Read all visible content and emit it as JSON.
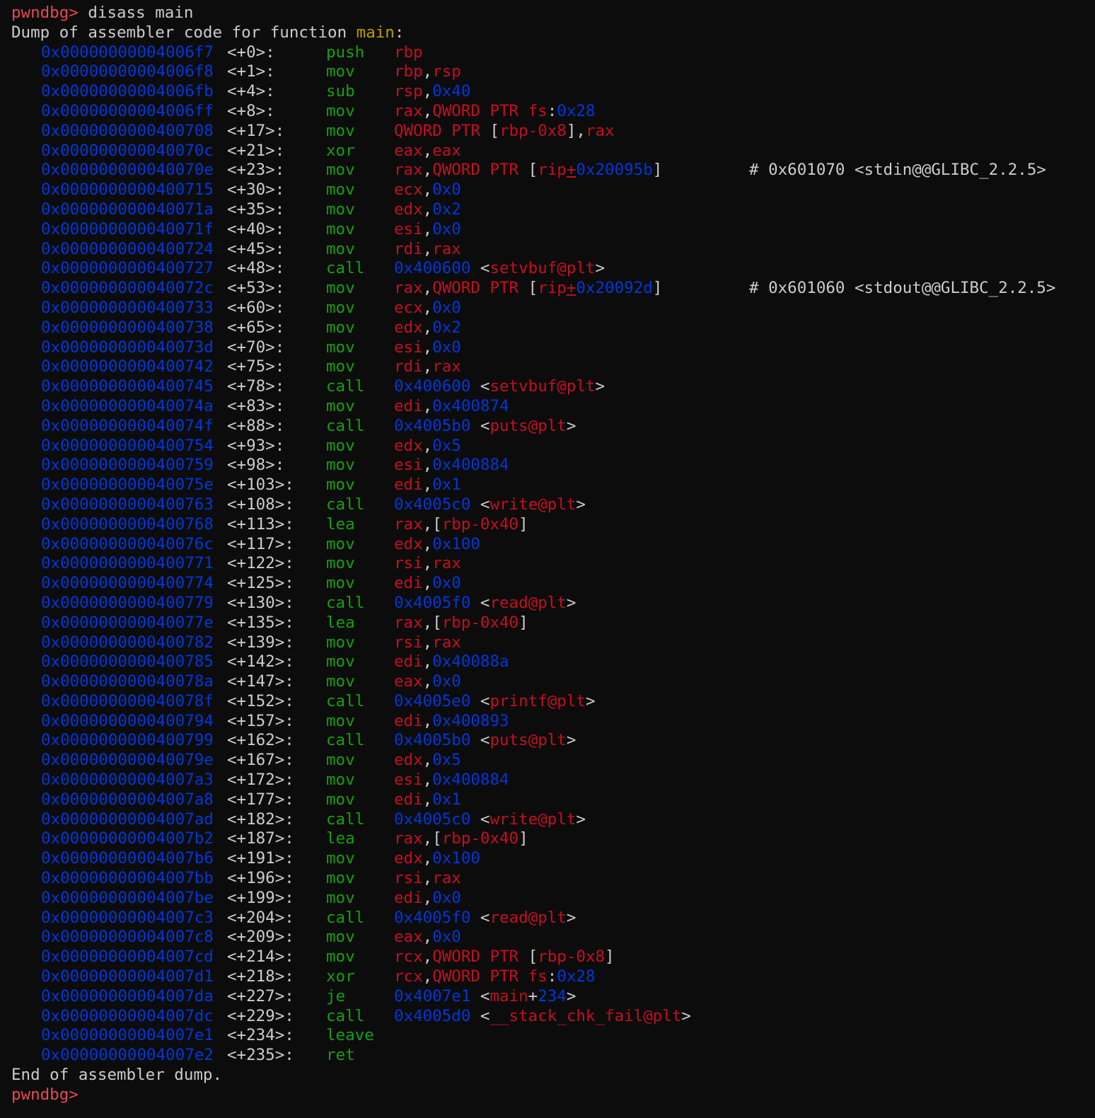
{
  "terminal": {
    "prompt": "pwndbg>",
    "command": "disass main",
    "header_prefix": "Dump of assembler code for function ",
    "function_name": "main",
    "header_suffix": ":",
    "footer": "End of assembler dump.",
    "final_prompt": "pwndbg>"
  },
  "colors": {
    "background": "#0c0c0c",
    "address": "#0037da",
    "mnemonic": "#13a10e",
    "register": "#c50f1f",
    "prompt": "#e74856",
    "function": "#c19c00",
    "text": "#cccccc"
  },
  "instructions": [
    {
      "addr": "0x00000000004006f7",
      "off": "<+0>:",
      "mnem": "push",
      "ops": [
        [
          "reg",
          "rbp"
        ]
      ]
    },
    {
      "addr": "0x00000000004006f8",
      "off": "<+1>:",
      "mnem": "mov",
      "ops": [
        [
          "reg",
          "rbp"
        ],
        [
          "txt",
          ","
        ],
        [
          "reg",
          "rsp"
        ]
      ]
    },
    {
      "addr": "0x00000000004006fb",
      "off": "<+4>:",
      "mnem": "sub",
      "ops": [
        [
          "reg",
          "rsp"
        ],
        [
          "txt",
          ","
        ],
        [
          "num",
          "0x40"
        ]
      ]
    },
    {
      "addr": "0x00000000004006ff",
      "off": "<+8>:",
      "mnem": "mov",
      "ops": [
        [
          "reg",
          "rax"
        ],
        [
          "txt",
          ","
        ],
        [
          "reg",
          "QWORD PTR fs"
        ],
        [
          "txt",
          ":"
        ],
        [
          "num",
          "0x28"
        ]
      ]
    },
    {
      "addr": "0x0000000000400708",
      "off": "<+17>:",
      "mnem": "mov",
      "ops": [
        [
          "reg",
          "QWORD PTR "
        ],
        [
          "txt",
          "["
        ],
        [
          "reg",
          "rbp-0x8"
        ],
        [
          "txt",
          "]"
        ],
        [
          "txt",
          ","
        ],
        [
          "reg",
          "rax"
        ]
      ]
    },
    {
      "addr": "0x000000000040070c",
      "off": "<+21>:",
      "mnem": "xor",
      "ops": [
        [
          "reg",
          "eax"
        ],
        [
          "txt",
          ","
        ],
        [
          "reg",
          "eax"
        ]
      ]
    },
    {
      "addr": "0x000000000040070e",
      "off": "<+23>:",
      "mnem": "mov",
      "ops": [
        [
          "reg",
          "rax"
        ],
        [
          "txt",
          ","
        ],
        [
          "reg",
          "QWORD PTR "
        ],
        [
          "txt",
          "["
        ],
        [
          "reg",
          "rip"
        ],
        [
          "reg_u",
          "+"
        ],
        [
          "num",
          "0x20095b"
        ],
        [
          "txt",
          "]"
        ]
      ],
      "comment": "# 0x601070 <stdin@@GLIBC_2.2.5>"
    },
    {
      "addr": "0x0000000000400715",
      "off": "<+30>:",
      "mnem": "mov",
      "ops": [
        [
          "reg",
          "ecx"
        ],
        [
          "txt",
          ","
        ],
        [
          "num",
          "0x0"
        ]
      ]
    },
    {
      "addr": "0x000000000040071a",
      "off": "<+35>:",
      "mnem": "mov",
      "ops": [
        [
          "reg",
          "edx"
        ],
        [
          "txt",
          ","
        ],
        [
          "num",
          "0x2"
        ]
      ]
    },
    {
      "addr": "0x000000000040071f",
      "off": "<+40>:",
      "mnem": "mov",
      "ops": [
        [
          "reg",
          "esi"
        ],
        [
          "txt",
          ","
        ],
        [
          "num",
          "0x0"
        ]
      ]
    },
    {
      "addr": "0x0000000000400724",
      "off": "<+45>:",
      "mnem": "mov",
      "ops": [
        [
          "reg",
          "rdi"
        ],
        [
          "txt",
          ","
        ],
        [
          "reg",
          "rax"
        ]
      ]
    },
    {
      "addr": "0x0000000000400727",
      "off": "<+48>:",
      "mnem": "call",
      "ops": [
        [
          "num",
          "0x400600"
        ],
        [
          "txt",
          " <"
        ],
        [
          "sym",
          "setvbuf@plt"
        ],
        [
          "txt",
          ">"
        ]
      ]
    },
    {
      "addr": "0x000000000040072c",
      "off": "<+53>:",
      "mnem": "mov",
      "ops": [
        [
          "reg",
          "rax"
        ],
        [
          "txt",
          ","
        ],
        [
          "reg",
          "QWORD PTR "
        ],
        [
          "txt",
          "["
        ],
        [
          "reg",
          "rip"
        ],
        [
          "reg_u",
          "+"
        ],
        [
          "num",
          "0x20092d"
        ],
        [
          "txt",
          "]"
        ]
      ],
      "comment": "# 0x601060 <stdout@@GLIBC_2.2.5>"
    },
    {
      "addr": "0x0000000000400733",
      "off": "<+60>:",
      "mnem": "mov",
      "ops": [
        [
          "reg",
          "ecx"
        ],
        [
          "txt",
          ","
        ],
        [
          "num",
          "0x0"
        ]
      ]
    },
    {
      "addr": "0x0000000000400738",
      "off": "<+65>:",
      "mnem": "mov",
      "ops": [
        [
          "reg",
          "edx"
        ],
        [
          "txt",
          ","
        ],
        [
          "num",
          "0x2"
        ]
      ]
    },
    {
      "addr": "0x000000000040073d",
      "off": "<+70>:",
      "mnem": "mov",
      "ops": [
        [
          "reg",
          "esi"
        ],
        [
          "txt",
          ","
        ],
        [
          "num",
          "0x0"
        ]
      ]
    },
    {
      "addr": "0x0000000000400742",
      "off": "<+75>:",
      "mnem": "mov",
      "ops": [
        [
          "reg",
          "rdi"
        ],
        [
          "txt",
          ","
        ],
        [
          "reg",
          "rax"
        ]
      ]
    },
    {
      "addr": "0x0000000000400745",
      "off": "<+78>:",
      "mnem": "call",
      "ops": [
        [
          "num",
          "0x400600"
        ],
        [
          "txt",
          " <"
        ],
        [
          "sym",
          "setvbuf@plt"
        ],
        [
          "txt",
          ">"
        ]
      ]
    },
    {
      "addr": "0x000000000040074a",
      "off": "<+83>:",
      "mnem": "mov",
      "ops": [
        [
          "reg",
          "edi"
        ],
        [
          "txt",
          ","
        ],
        [
          "num",
          "0x400874"
        ]
      ]
    },
    {
      "addr": "0x000000000040074f",
      "off": "<+88>:",
      "mnem": "call",
      "ops": [
        [
          "num",
          "0x4005b0"
        ],
        [
          "txt",
          " <"
        ],
        [
          "sym",
          "puts@plt"
        ],
        [
          "txt",
          ">"
        ]
      ]
    },
    {
      "addr": "0x0000000000400754",
      "off": "<+93>:",
      "mnem": "mov",
      "ops": [
        [
          "reg",
          "edx"
        ],
        [
          "txt",
          ","
        ],
        [
          "num",
          "0x5"
        ]
      ]
    },
    {
      "addr": "0x0000000000400759",
      "off": "<+98>:",
      "mnem": "mov",
      "ops": [
        [
          "reg",
          "esi"
        ],
        [
          "txt",
          ","
        ],
        [
          "num",
          "0x400884"
        ]
      ]
    },
    {
      "addr": "0x000000000040075e",
      "off": "<+103>:",
      "mnem": "mov",
      "ops": [
        [
          "reg",
          "edi"
        ],
        [
          "txt",
          ","
        ],
        [
          "num",
          "0x1"
        ]
      ]
    },
    {
      "addr": "0x0000000000400763",
      "off": "<+108>:",
      "mnem": "call",
      "ops": [
        [
          "num",
          "0x4005c0"
        ],
        [
          "txt",
          " <"
        ],
        [
          "sym",
          "write@plt"
        ],
        [
          "txt",
          ">"
        ]
      ]
    },
    {
      "addr": "0x0000000000400768",
      "off": "<+113>:",
      "mnem": "lea",
      "ops": [
        [
          "reg",
          "rax"
        ],
        [
          "txt",
          ","
        ],
        [
          "txt",
          "["
        ],
        [
          "reg",
          "rbp-0x40"
        ],
        [
          "txt",
          "]"
        ]
      ]
    },
    {
      "addr": "0x000000000040076c",
      "off": "<+117>:",
      "mnem": "mov",
      "ops": [
        [
          "reg",
          "edx"
        ],
        [
          "txt",
          ","
        ],
        [
          "num",
          "0x100"
        ]
      ]
    },
    {
      "addr": "0x0000000000400771",
      "off": "<+122>:",
      "mnem": "mov",
      "ops": [
        [
          "reg",
          "rsi"
        ],
        [
          "txt",
          ","
        ],
        [
          "reg",
          "rax"
        ]
      ]
    },
    {
      "addr": "0x0000000000400774",
      "off": "<+125>:",
      "mnem": "mov",
      "ops": [
        [
          "reg",
          "edi"
        ],
        [
          "txt",
          ","
        ],
        [
          "num",
          "0x0"
        ]
      ]
    },
    {
      "addr": "0x0000000000400779",
      "off": "<+130>:",
      "mnem": "call",
      "ops": [
        [
          "num",
          "0x4005f0"
        ],
        [
          "txt",
          " <"
        ],
        [
          "sym",
          "read@plt"
        ],
        [
          "txt",
          ">"
        ]
      ]
    },
    {
      "addr": "0x000000000040077e",
      "off": "<+135>:",
      "mnem": "lea",
      "ops": [
        [
          "reg",
          "rax"
        ],
        [
          "txt",
          ","
        ],
        [
          "txt",
          "["
        ],
        [
          "reg",
          "rbp-0x40"
        ],
        [
          "txt",
          "]"
        ]
      ]
    },
    {
      "addr": "0x0000000000400782",
      "off": "<+139>:",
      "mnem": "mov",
      "ops": [
        [
          "reg",
          "rsi"
        ],
        [
          "txt",
          ","
        ],
        [
          "reg",
          "rax"
        ]
      ]
    },
    {
      "addr": "0x0000000000400785",
      "off": "<+142>:",
      "mnem": "mov",
      "ops": [
        [
          "reg",
          "edi"
        ],
        [
          "txt",
          ","
        ],
        [
          "num",
          "0x40088a"
        ]
      ]
    },
    {
      "addr": "0x000000000040078a",
      "off": "<+147>:",
      "mnem": "mov",
      "ops": [
        [
          "reg",
          "eax"
        ],
        [
          "txt",
          ","
        ],
        [
          "num",
          "0x0"
        ]
      ]
    },
    {
      "addr": "0x000000000040078f",
      "off": "<+152>:",
      "mnem": "call",
      "ops": [
        [
          "num",
          "0x4005e0"
        ],
        [
          "txt",
          " <"
        ],
        [
          "sym",
          "printf@plt"
        ],
        [
          "txt",
          ">"
        ]
      ]
    },
    {
      "addr": "0x0000000000400794",
      "off": "<+157>:",
      "mnem": "mov",
      "ops": [
        [
          "reg",
          "edi"
        ],
        [
          "txt",
          ","
        ],
        [
          "num",
          "0x400893"
        ]
      ]
    },
    {
      "addr": "0x0000000000400799",
      "off": "<+162>:",
      "mnem": "call",
      "ops": [
        [
          "num",
          "0x4005b0"
        ],
        [
          "txt",
          " <"
        ],
        [
          "sym",
          "puts@plt"
        ],
        [
          "txt",
          ">"
        ]
      ]
    },
    {
      "addr": "0x000000000040079e",
      "off": "<+167>:",
      "mnem": "mov",
      "ops": [
        [
          "reg",
          "edx"
        ],
        [
          "txt",
          ","
        ],
        [
          "num",
          "0x5"
        ]
      ]
    },
    {
      "addr": "0x00000000004007a3",
      "off": "<+172>:",
      "mnem": "mov",
      "ops": [
        [
          "reg",
          "esi"
        ],
        [
          "txt",
          ","
        ],
        [
          "num",
          "0x400884"
        ]
      ]
    },
    {
      "addr": "0x00000000004007a8",
      "off": "<+177>:",
      "mnem": "mov",
      "ops": [
        [
          "reg",
          "edi"
        ],
        [
          "txt",
          ","
        ],
        [
          "num",
          "0x1"
        ]
      ]
    },
    {
      "addr": "0x00000000004007ad",
      "off": "<+182>:",
      "mnem": "call",
      "ops": [
        [
          "num",
          "0x4005c0"
        ],
        [
          "txt",
          " <"
        ],
        [
          "sym",
          "write@plt"
        ],
        [
          "txt",
          ">"
        ]
      ]
    },
    {
      "addr": "0x00000000004007b2",
      "off": "<+187>:",
      "mnem": "lea",
      "ops": [
        [
          "reg",
          "rax"
        ],
        [
          "txt",
          ","
        ],
        [
          "txt",
          "["
        ],
        [
          "reg",
          "rbp-0x40"
        ],
        [
          "txt",
          "]"
        ]
      ]
    },
    {
      "addr": "0x00000000004007b6",
      "off": "<+191>:",
      "mnem": "mov",
      "ops": [
        [
          "reg",
          "edx"
        ],
        [
          "txt",
          ","
        ],
        [
          "num",
          "0x100"
        ]
      ]
    },
    {
      "addr": "0x00000000004007bb",
      "off": "<+196>:",
      "mnem": "mov",
      "ops": [
        [
          "reg",
          "rsi"
        ],
        [
          "txt",
          ","
        ],
        [
          "reg",
          "rax"
        ]
      ]
    },
    {
      "addr": "0x00000000004007be",
      "off": "<+199>:",
      "mnem": "mov",
      "ops": [
        [
          "reg",
          "edi"
        ],
        [
          "txt",
          ","
        ],
        [
          "num",
          "0x0"
        ]
      ]
    },
    {
      "addr": "0x00000000004007c3",
      "off": "<+204>:",
      "mnem": "call",
      "ops": [
        [
          "num",
          "0x4005f0"
        ],
        [
          "txt",
          " <"
        ],
        [
          "sym",
          "read@plt"
        ],
        [
          "txt",
          ">"
        ]
      ]
    },
    {
      "addr": "0x00000000004007c8",
      "off": "<+209>:",
      "mnem": "mov",
      "ops": [
        [
          "reg",
          "eax"
        ],
        [
          "txt",
          ","
        ],
        [
          "num",
          "0x0"
        ]
      ]
    },
    {
      "addr": "0x00000000004007cd",
      "off": "<+214>:",
      "mnem": "mov",
      "ops": [
        [
          "reg",
          "rcx"
        ],
        [
          "txt",
          ","
        ],
        [
          "reg",
          "QWORD PTR "
        ],
        [
          "txt",
          "["
        ],
        [
          "reg",
          "rbp-0x8"
        ],
        [
          "txt",
          "]"
        ]
      ]
    },
    {
      "addr": "0x00000000004007d1",
      "off": "<+218>:",
      "mnem": "xor",
      "ops": [
        [
          "reg",
          "rcx"
        ],
        [
          "txt",
          ","
        ],
        [
          "reg",
          "QWORD PTR fs"
        ],
        [
          "txt",
          ":"
        ],
        [
          "num",
          "0x28"
        ]
      ]
    },
    {
      "addr": "0x00000000004007da",
      "off": "<+227>:",
      "mnem": "je",
      "ops": [
        [
          "num",
          "0x4007e1"
        ],
        [
          "txt",
          " <"
        ],
        [
          "sym",
          "main"
        ],
        [
          "txt",
          "+"
        ],
        [
          "num",
          "234"
        ],
        [
          "txt",
          ">"
        ]
      ]
    },
    {
      "addr": "0x00000000004007dc",
      "off": "<+229>:",
      "mnem": "call",
      "ops": [
        [
          "num",
          "0x4005d0"
        ],
        [
          "txt",
          " <"
        ],
        [
          "sym",
          "__stack_chk_fail@plt"
        ],
        [
          "txt",
          ">"
        ]
      ]
    },
    {
      "addr": "0x00000000004007e1",
      "off": "<+234>:",
      "mnem": "leave",
      "ops": []
    },
    {
      "addr": "0x00000000004007e2",
      "off": "<+235>:",
      "mnem": "ret",
      "ops": []
    }
  ]
}
